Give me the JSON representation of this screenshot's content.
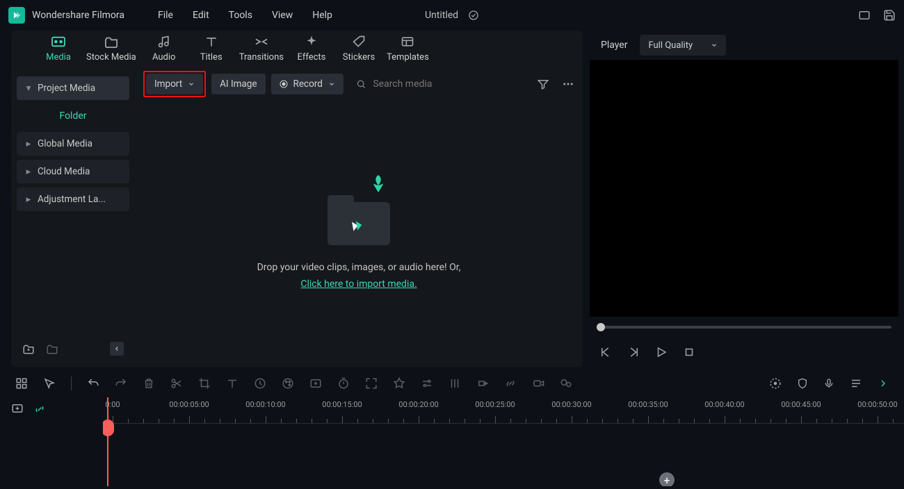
{
  "app_name": "Wondershare Filmora",
  "menu": [
    "File",
    "Edit",
    "Tools",
    "View",
    "Help"
  ],
  "project_title": "Untitled",
  "top_tabs": [
    {
      "label": "Media",
      "icon": "media-icon",
      "active": true
    },
    {
      "label": "Stock Media",
      "icon": "stock-media-icon"
    },
    {
      "label": "Audio",
      "icon": "audio-icon"
    },
    {
      "label": "Titles",
      "icon": "titles-icon"
    },
    {
      "label": "Transitions",
      "icon": "transitions-icon"
    },
    {
      "label": "Effects",
      "icon": "effects-icon"
    },
    {
      "label": "Stickers",
      "icon": "stickers-icon"
    },
    {
      "label": "Templates",
      "icon": "templates-icon"
    }
  ],
  "sidebar": {
    "project_media": "Project Media",
    "folder": "Folder",
    "items": [
      "Global Media",
      "Cloud Media",
      "Adjustment La..."
    ]
  },
  "toolbar": {
    "import": "Import",
    "ai_image": "AI Image",
    "record": "Record",
    "search_placeholder": "Search media"
  },
  "dropzone": {
    "line1": "Drop your video clips, images, or audio here! Or,",
    "link": "Click here to import media."
  },
  "player": {
    "label": "Player",
    "quality": "Full Quality"
  },
  "ruler_labels": [
    "0:00",
    "00:00:05:00",
    "00:00:10:00",
    "00:00:15:00",
    "00:00:20:00",
    "00:00:25:00",
    "00:00:30:00",
    "00:00:35:00",
    "00:00:40:00",
    "00:00:45:00",
    "00:00:50:00"
  ]
}
